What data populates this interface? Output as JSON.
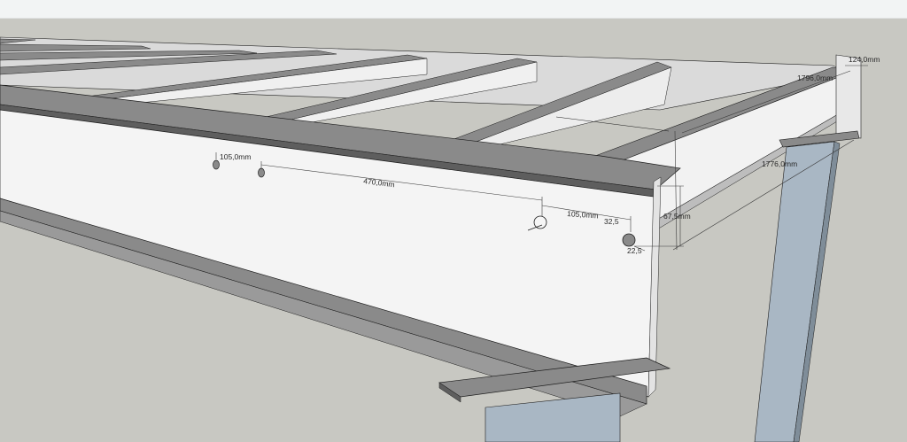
{
  "app": {
    "name": "SketchUp model viewport",
    "background_color": "#c8c8c2",
    "toolbar_color": "#f2f4f4"
  },
  "colors": {
    "flange_top": "#8a8a8a",
    "web_face": "#f4f4f4",
    "deck_panel": "#e6e6e6",
    "column_blue": "#a9b7c4",
    "edge_line": "#1e1e1e",
    "dimension_line": "#3a3a3a"
  },
  "dimensions": {
    "hole_spacing_left": "105,0mm",
    "hole_spacing_mid": "470,0mm",
    "hole_spacing_right": "105,0mm",
    "edge_offset_x": "32,5",
    "edge_offset_y": "22,5",
    "web_depth": "67,5mm",
    "beam_width": "124,0mm",
    "span_upper": "1796,0mm",
    "span_lower": "1776,0mm"
  }
}
